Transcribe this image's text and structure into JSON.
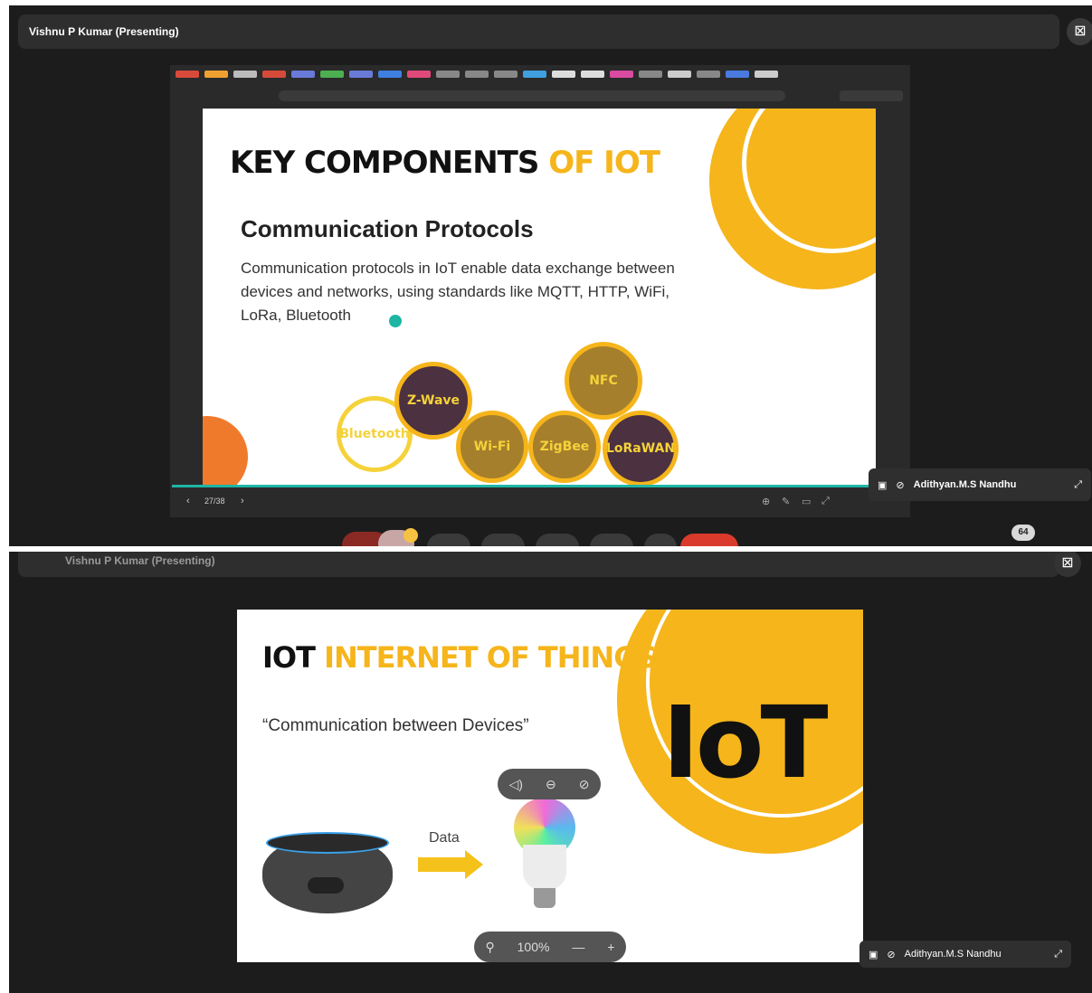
{
  "colors": {
    "accent_yellow": "#f5b51b",
    "dark_bg": "#1c1c1c",
    "bubble_gold": "#a67f2c",
    "bubble_plum": "#4c3140",
    "orange": "#f07a2c"
  },
  "top": {
    "presenter": "Vishnu P Kumar (Presenting)",
    "slide": {
      "title_black": "KEY COMPONENTS",
      "title_yellow": "OF IOT",
      "heading": "Communication Protocols",
      "body": "Communication protocols in IoT enable data exchange between devices and networks, using standards like MQTT, HTTP, WiFi, LoRa, Bluetooth",
      "bubbles": [
        "Bluetooth",
        "Z-Wave",
        "Wi-Fi",
        "ZigBee",
        "LoRaWAN",
        "NFC"
      ]
    },
    "page_indicator": "27/38",
    "participant": "Adithyan.M.S Nandhu",
    "participant_count": "64"
  },
  "bottom": {
    "presenter": "Vishnu P Kumar (Presenting)",
    "slide": {
      "title_black": "IOT",
      "title_yellow": "INTERNET OF THINGS",
      "quote": "“Communication between Devices”",
      "arrow_label": "Data",
      "logo_text": "IoT"
    },
    "zoom_level": "100%",
    "participant": "Adithyan.M.S Nandhu"
  },
  "icons": [
    "present-icon",
    "camera-off-icon",
    "expand-icon",
    "pin-icon",
    "speaker-icon",
    "minus-circle-icon",
    "zoom-in-icon",
    "zoom-out-icon",
    "plus-icon"
  ]
}
